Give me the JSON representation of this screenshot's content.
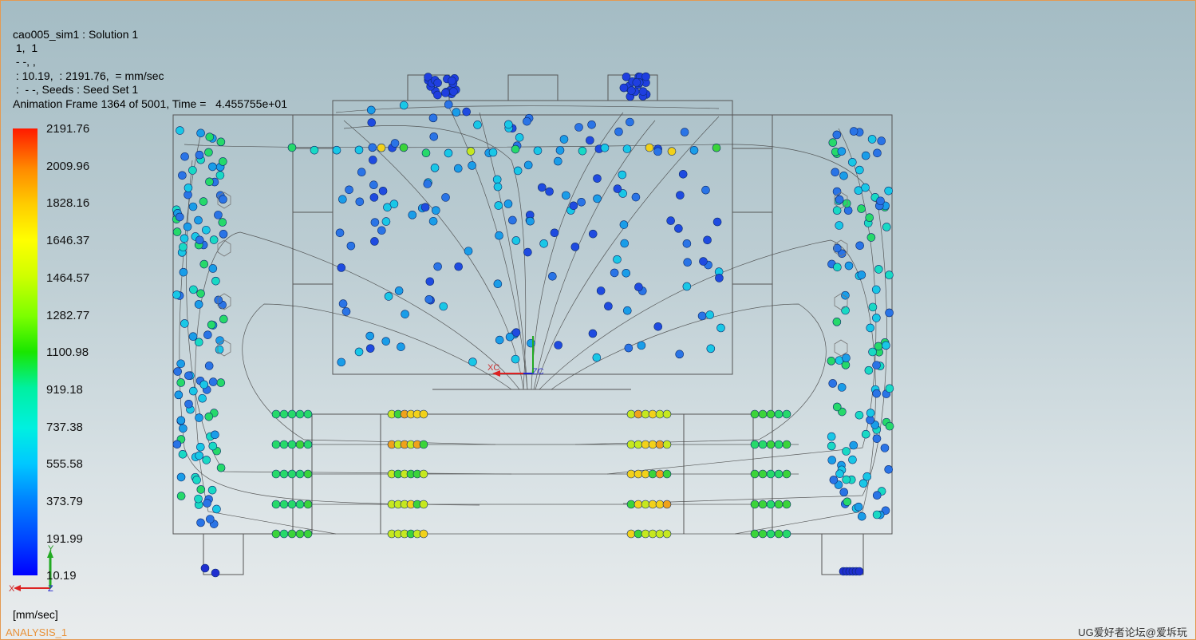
{
  "header": {
    "line1": "cao005_sim1 : Solution 1",
    "line2": " 1,  1",
    "line3": " - -, ,",
    "line4": " : 10.19,  : 2191.76,  = mm/sec",
    "line5": " :  - -, Seeds : Seed Set 1",
    "line6": "Animation Frame 1364 of 5001, Time =   4.455755e+01"
  },
  "legend": {
    "ticks": [
      "2191.76",
      "2009.96",
      "1828.16",
      "1646.37",
      "1464.57",
      "1282.77",
      "1100.98",
      "919.18",
      "737.38",
      "555.58",
      "373.79",
      "191.99",
      "10.19"
    ],
    "units": "[mm/sec]"
  },
  "triad": {
    "x": "X",
    "y": "Y",
    "z": "Z"
  },
  "csys": {
    "xc": "XC",
    "zc": "ZC"
  },
  "footer": {
    "analysis": "ANALYSIS_1",
    "watermark": "UG爱好者论坛@爱坼玩"
  },
  "colors": {
    "frame": "#e49a52",
    "bg_top": "#a4bcc4",
    "bg_bottom": "#e9eced"
  }
}
